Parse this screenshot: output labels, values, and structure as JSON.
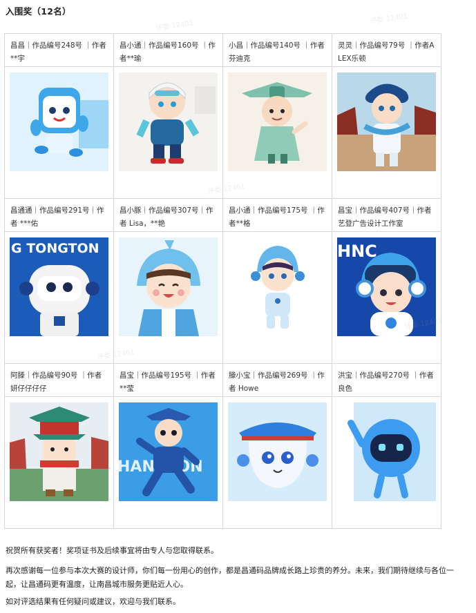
{
  "heading": "入围奖（12名）",
  "watermark": "评委 12401",
  "entries": [
    {
      "caption": "昌昌｜作品编号248号 ｜作者**宇",
      "icon": "blue-box-mascot"
    },
    {
      "caption": "昌小通｜作品编号160号 ｜作者**瑜",
      "icon": "helmet-boy-mascot"
    },
    {
      "caption": "小昌｜作品编号140号 ｜作者芬迪克",
      "icon": "green-pavilion-mascot"
    },
    {
      "caption": "灵灵｜作品编号79号 ｜作者ALEX乐顿",
      "icon": "blue-hair-mascot"
    },
    {
      "caption": "昌通通｜作品编号291号｜作者 ***佑",
      "icon": "tongtong-robot-mascot",
      "img_text": "G TONGTON"
    },
    {
      "caption": "昌小豚｜作品编号307号｜作者 Lisa，**艳",
      "icon": "dolphin-hood-girl-mascot"
    },
    {
      "caption": "昌小通｜作品编号175号 ｜作者**格",
      "icon": "astronaut-dolphin-mascot"
    },
    {
      "caption": "昌宝｜作品编号407号｜作者 艺登广告设计工作室",
      "icon": "headphone-dolphin-mascot",
      "img_text": "HNC"
    },
    {
      "caption": "阿滕｜作品编号90号 ｜作者 妍仔仔仔仔",
      "icon": "tengwang-tower-mascot"
    },
    {
      "caption": "昌宝｜作品编号195号 ｜作者**莹",
      "icon": "robot-runner-mascot",
      "img_text": "HANGTON"
    },
    {
      "caption": "滕小宝｜作品编号269号 ｜作者 Howe",
      "icon": "roof-ghost-mascot"
    },
    {
      "caption": "洪宝｜作品编号270号 ｜作者 良色",
      "icon": "screen-face-mascot"
    }
  ],
  "paragraphs": [
    "祝贺所有获奖者！奖项证书及后续事宜将由专人与您取得联系。",
    "再次感谢每一位参与本次大赛的设计师，你们每一份用心的创作，都是昌通码品牌成长路上珍贵的养分。未来，我们期待继续与各位一起，让昌通码更有温度，让南昌城市服务更贴近人心。",
    "如对评选结果有任何疑问或建议，欢迎与我们联系。"
  ],
  "colors": {
    "border": "#d6d6d6",
    "text": "#222222",
    "brand_blue": "#1f7fe0"
  }
}
